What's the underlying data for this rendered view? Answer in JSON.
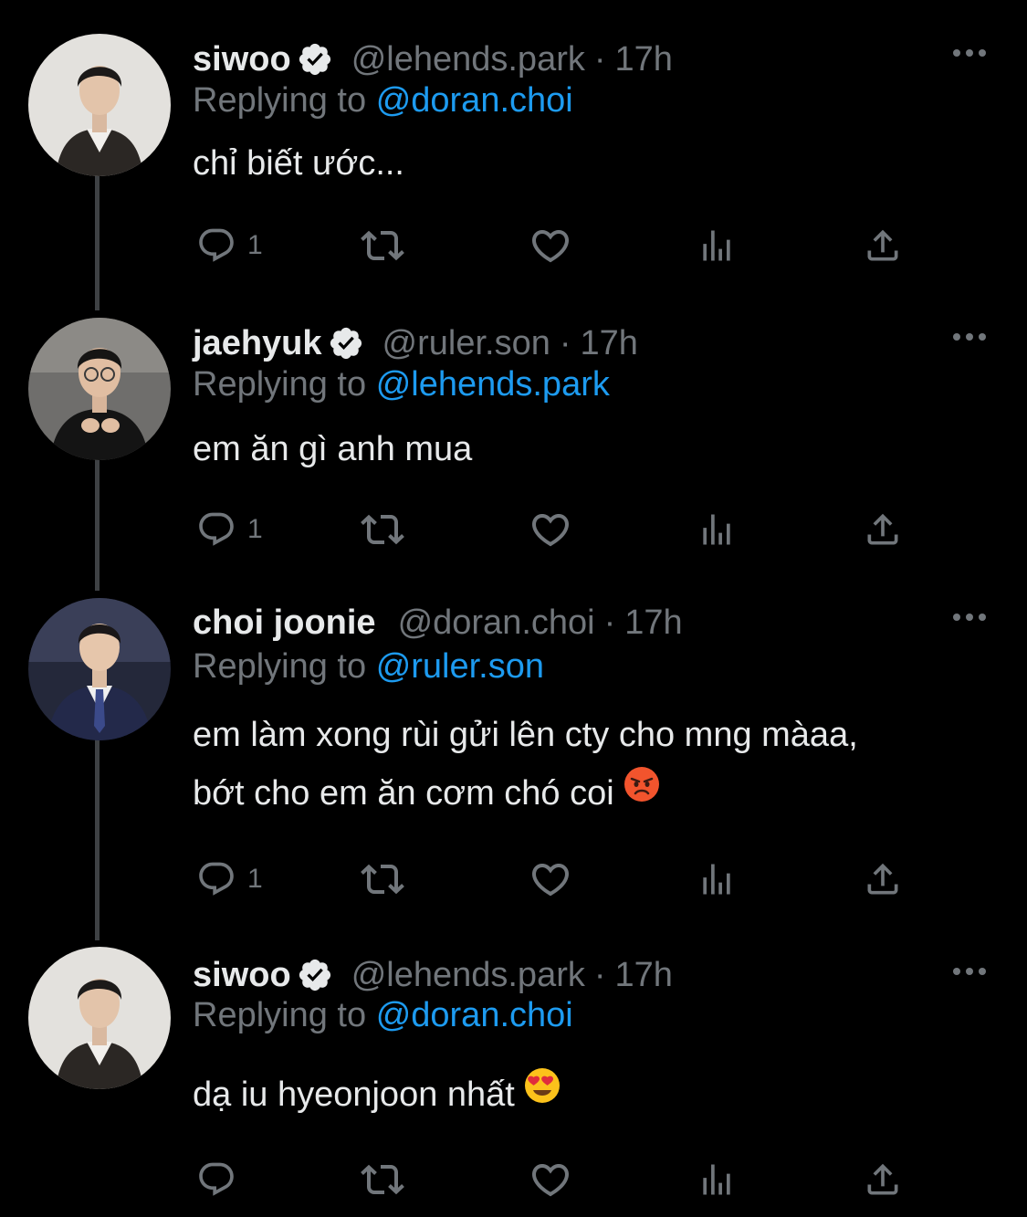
{
  "tweets": [
    {
      "name": "siwoo",
      "verified": true,
      "handle": "@lehends.park",
      "separator": "·",
      "time": "17h",
      "replying_prefix": "Replying to",
      "replying_to": "@doran.choi",
      "text_lines": [
        "chỉ biết ước..."
      ],
      "reply_count": "1",
      "avatar": "avatar-siwoo"
    },
    {
      "name": "jaehyuk",
      "verified": true,
      "handle": "@ruler.son",
      "separator": "·",
      "time": "17h",
      "replying_prefix": "Replying to",
      "replying_to": "@lehends.park",
      "text_lines": [
        "em ăn gì anh mua"
      ],
      "reply_count": "1",
      "avatar": "avatar-jaehyuk"
    },
    {
      "name": "choi joonie",
      "verified": false,
      "handle": "@doran.choi",
      "separator": "·",
      "time": "17h",
      "replying_prefix": "Replying to",
      "replying_to": "@ruler.son",
      "text_lines": [
        "em làm xong rùi gửi lên cty cho mng màaa,",
        "bớt cho em ăn cơm chó coi"
      ],
      "text_emoji": "angry-face",
      "reply_count": "1",
      "avatar": "avatar-choi-joonie"
    },
    {
      "name": "siwoo",
      "verified": true,
      "handle": "@lehends.park",
      "separator": "·",
      "time": "17h",
      "replying_prefix": "Replying to",
      "replying_to": "@doran.choi",
      "text_lines": [
        "dạ iu hyeonjoon nhất"
      ],
      "text_emoji": "heart-eyes-face",
      "reply_count": "",
      "avatar": "avatar-siwoo"
    }
  ],
  "icons": {
    "reply": "reply-icon",
    "retweet": "retweet-icon",
    "like": "like-icon",
    "views": "views-icon",
    "share": "share-icon",
    "more": "more-icon",
    "verified": "verified-badge-icon"
  },
  "colors": {
    "background": "#000000",
    "primary_text": "#e7e9ea",
    "secondary_text": "#71767b",
    "link": "#1d9bf0",
    "thread_line": "#3e4144"
  }
}
